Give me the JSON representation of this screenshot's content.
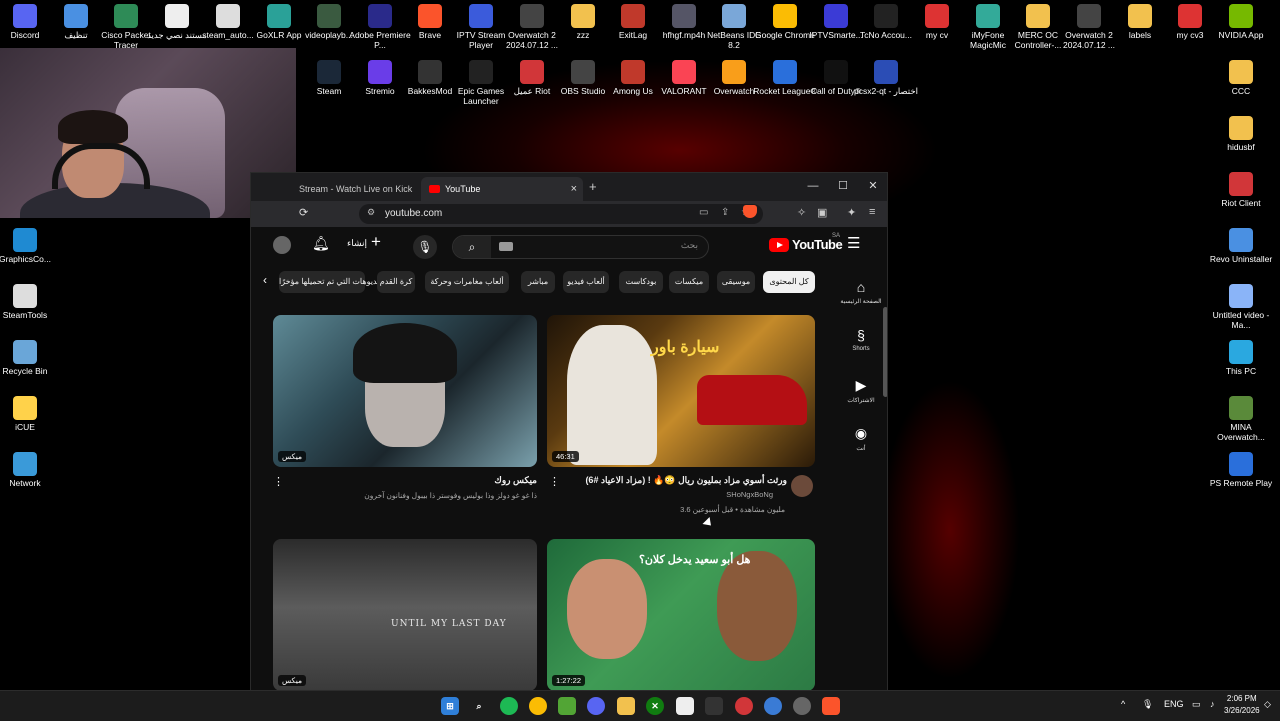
{
  "desktop": {
    "top_row": [
      "Discord",
      "تنظيف",
      "Cisco Packet Tracer",
      "مستند نصي جديد",
      "steam_auto...",
      "GoXLR App",
      "videoplayb...",
      "Adobe Premiere P...",
      "Brave",
      "IPTV Stream Player",
      "Overwatch 2 2024.07.12 ...",
      "zzz",
      "ExitLag",
      "hfhgf.mp4h",
      "NetBeans IDE 8.2",
      "Google Chrome",
      "IPTVSmarte...",
      "TcNo Accou...",
      "my cv",
      "iMyFone MagicMic",
      "MERC OC Controller-...",
      "Overwatch 2 2024.07.12 ...",
      "labels",
      "my cv3",
      "NVIDIA App"
    ],
    "second_row": [
      "Steam",
      "Stremio",
      "BakkesMod",
      "Epic Games Launcher",
      "عميل Riot",
      "OBS Studio",
      "Among Us",
      "VALORANT",
      "Overwatch",
      "Rocket League®",
      "Call of Duty®",
      "pcsx2-qt - اختصار"
    ],
    "left_col": [
      "GraphicsCo...",
      "SteamTools",
      "Recycle Bin",
      "iCUE",
      "Network"
    ],
    "right_col": [
      "CCC",
      "hidusbf",
      "Riot Client",
      "Revo Uninstaller",
      "Untitled video - Ma...",
      "This PC",
      "MINA Overwatch...",
      "PS Remote Play"
    ]
  },
  "browser": {
    "tabs": [
      {
        "label": "Stream - Watch Live on Kick",
        "active": false
      },
      {
        "label": "YouTube",
        "active": true
      }
    ],
    "new_tab": "+",
    "url": "youtube.com",
    "window_controls": {
      "minimize": "—",
      "maximize": "☐",
      "close": "✕"
    }
  },
  "youtube": {
    "logo": "YouTube",
    "country": "SA",
    "search_placeholder": "بحث",
    "create_label": "إنشاء",
    "chips": [
      "كل المحتوى",
      "موسيقى",
      "ميكسات",
      "بودكاست",
      "ألعاب فيديو",
      "مباشر",
      "ألعاب مغامرات وحركة",
      "كرة القدم",
      "الفيديوهات التي تم تحميلها مؤخرًا"
    ],
    "sidebar": [
      "الصفحة الرئيسية",
      "Shorts",
      "الاشتراكات",
      "أنت"
    ],
    "videos": [
      {
        "title": "ميكس روك",
        "subtitle": "ذا غو غو دولز وذا بولیس وفوستر ذا بيبول وفنانون آخرون",
        "badge": "ميكس",
        "overlay_text": ""
      },
      {
        "title": "(6# ورثت أسوي مزاد بمليون ريال 😳🔥 ! (مزاد الاعياد",
        "channel": "SHoNgxBoNg",
        "meta": "3.6 مليون مشاهدة • قبل أسبوعين",
        "duration": "46:31",
        "overlay_text": "سيارة باور"
      },
      {
        "title": "",
        "badge": "ميكس",
        "overlay_text": "UNTIL MY LAST DAY"
      },
      {
        "title": "",
        "duration": "1:27:22",
        "overlay_text": "هل أبو سعيد يدخل كلان؟"
      }
    ]
  },
  "taskbar": {
    "lang": "ENG",
    "time": "2:06 PM",
    "date": "3/26/2026"
  },
  "colors": {
    "yt_red": "#ff0000",
    "bg": "#0f0f0f",
    "chip": "#272727",
    "brave": "#fb542b"
  }
}
